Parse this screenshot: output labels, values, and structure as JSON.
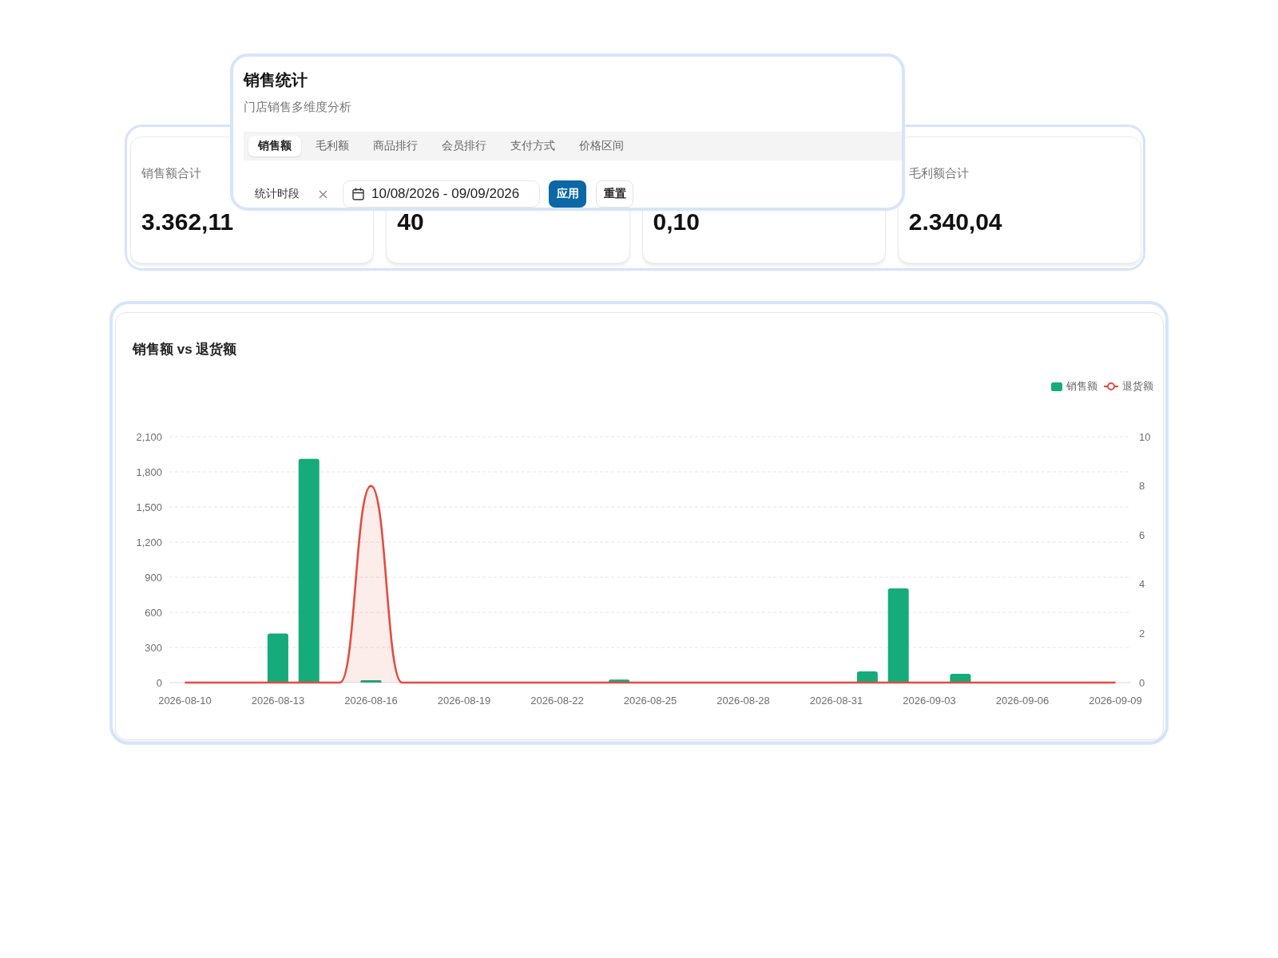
{
  "header": {
    "title": "销售统计",
    "subtitle": "门店销售多维度分析",
    "tabs": [
      {
        "label": "销售额",
        "selected": true
      },
      {
        "label": "毛利额",
        "selected": false
      },
      {
        "label": "商品排行",
        "selected": false
      },
      {
        "label": "会员排行",
        "selected": false
      },
      {
        "label": "支付方式",
        "selected": false
      },
      {
        "label": "价格区间",
        "selected": false
      }
    ],
    "filter": {
      "label": "统计时段",
      "date_range": "10/08/2026 - 09/09/2026",
      "buttons": [
        {
          "label": "应用",
          "kind": "primary"
        },
        {
          "label": "重置",
          "kind": "default"
        }
      ]
    }
  },
  "stat_cards": [
    {
      "label": "销售额合计",
      "value": "3.362,11"
    },
    {
      "value": "40"
    },
    {
      "value": "0,10"
    },
    {
      "label": "毛利额合计",
      "value": "2.340,04"
    }
  ],
  "chart_card": {
    "chart_data": {
      "type": "bar",
      "title": "销售额 vs 退货额",
      "grid": true,
      "categories": [
        "2026-08-10",
        null,
        null,
        "2026-08-13",
        null,
        null,
        "2026-08-16",
        null,
        null,
        "2026-08-19",
        null,
        null,
        "2026-08-22",
        null,
        null,
        "2026-08-25",
        null,
        null,
        "2026-08-28",
        null,
        null,
        "2026-08-31",
        null,
        null,
        "2026-09-03",
        null,
        null,
        "2026-09-06",
        null,
        null,
        "2026-09-09"
      ],
      "ylim": [
        0,
        2100
      ],
      "yticks": [
        0,
        300,
        600,
        900,
        {
          "value": 1200,
          "label": "1,200"
        },
        {
          "value": 1500,
          "label": "1,500"
        },
        {
          "value": 1800,
          "label": "1,800"
        },
        {
          "value": 2100,
          "label": "2,100"
        }
      ],
      "y2lim": [
        0,
        10
      ],
      "y2ticks": [
        0,
        2,
        4,
        6,
        8,
        10
      ],
      "series": [
        {
          "name": "销售额",
          "color": "#16ab7a",
          "values": [
            0,
            0,
            0,
            420,
            1910,
            0,
            20,
            0,
            0,
            0,
            0,
            0,
            0,
            0,
            25,
            0,
            0,
            0,
            0,
            0,
            0,
            0,
            95,
            805,
            0,
            75,
            0,
            0,
            0,
            0,
            0
          ]
        },
        {
          "name": "退货额",
          "color": "#e24c3f",
          "type": "area",
          "axis": "y2",
          "values": [
            0,
            0,
            0,
            0,
            0,
            0,
            8,
            0,
            0,
            0,
            0,
            0,
            0,
            0,
            0,
            0,
            0,
            0,
            0,
            0,
            0,
            0,
            0,
            0,
            0,
            0,
            0,
            0,
            0,
            0,
            0
          ]
        }
      ]
    }
  }
}
